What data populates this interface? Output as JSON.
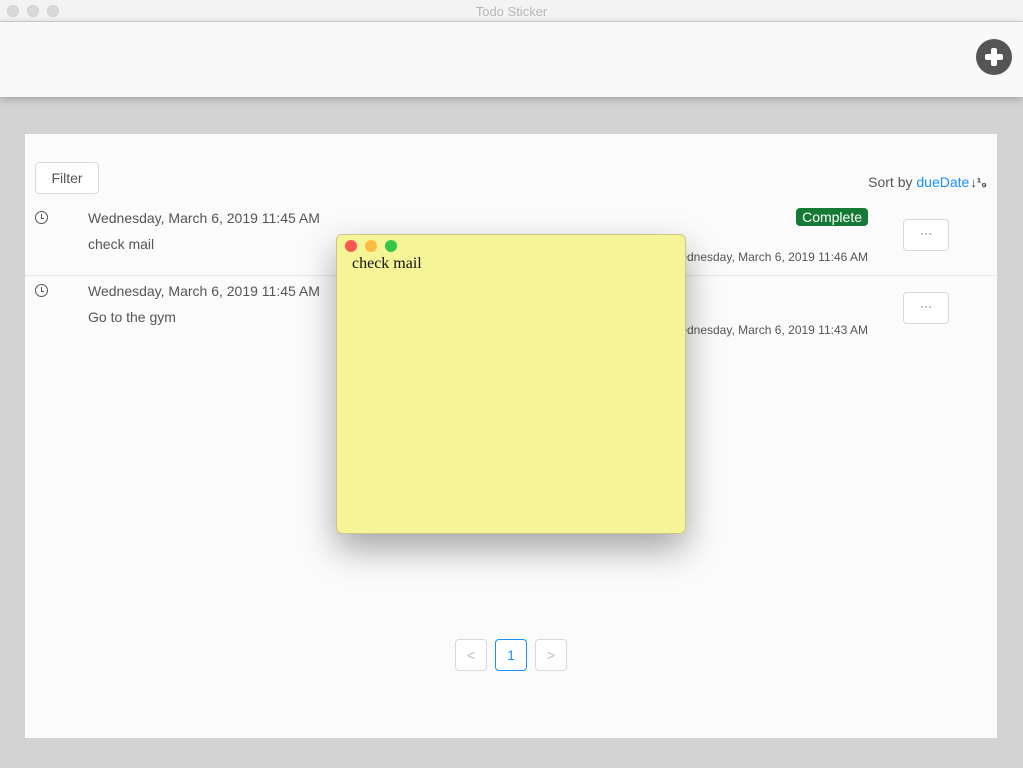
{
  "window": {
    "title": "Todo Sticker"
  },
  "header": {
    "add_button": "add-icon"
  },
  "toolbar": {
    "filter_label": "Filter",
    "sort_prefix": "Sort by",
    "sort_field": "dueDate",
    "sort_icon": "↓¹₉"
  },
  "todos": [
    {
      "due": "Wednesday, March 6, 2019 11:45 AM",
      "name": "check mail",
      "status": "Complete",
      "created": "Wednesday, March 6, 2019 11:46 AM",
      "more": "···"
    },
    {
      "due": "Wednesday, March 6, 2019 11:45 AM",
      "name": "Go to the gym",
      "status": "",
      "created": "Wednesday, March 6, 2019 11:43 AM",
      "more": "···"
    }
  ],
  "pagination": {
    "prev": "<",
    "current": "1",
    "next": ">"
  },
  "sticker": {
    "text": "check mail",
    "colors": {
      "background": "#f5f497",
      "close": "#fc5753",
      "minimize": "#fdbc40",
      "maximize": "#33c748"
    }
  },
  "colors": {
    "accent": "#1890ff",
    "complete_badge": "#157a35"
  }
}
